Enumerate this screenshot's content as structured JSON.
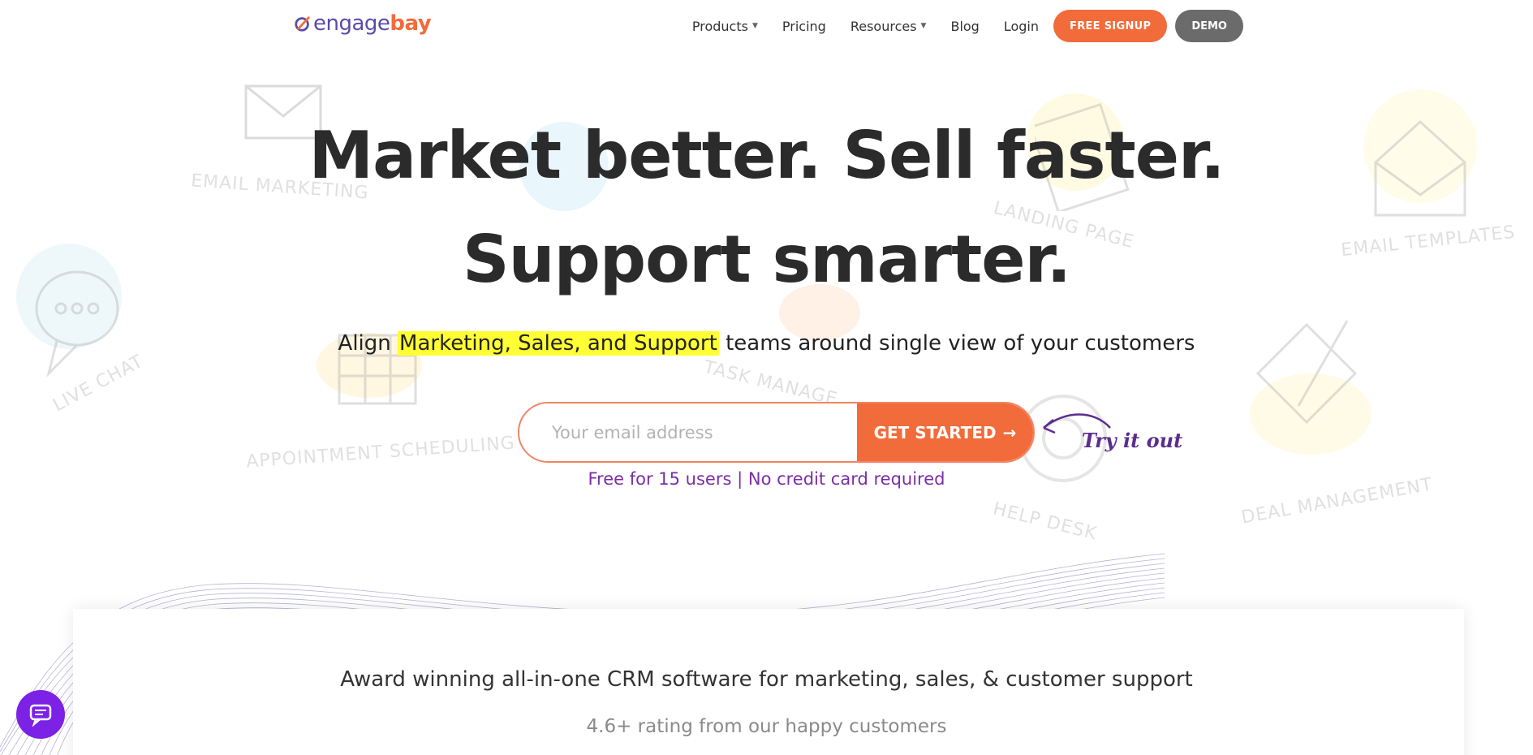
{
  "brand": {
    "engage": "engage",
    "bay": "bay",
    "primary": "#5b4aa8",
    "accent": "#f26b3a"
  },
  "nav": {
    "items": [
      {
        "label": "Products",
        "has_dropdown": true
      },
      {
        "label": "Pricing",
        "has_dropdown": false
      },
      {
        "label": "Resources",
        "has_dropdown": true
      },
      {
        "label": "Blog",
        "has_dropdown": false
      },
      {
        "label": "Login",
        "has_dropdown": false
      }
    ],
    "signup_label": "FREE SIGNUP",
    "demo_label": "DEMO"
  },
  "background_labels": {
    "email_marketing": "EMAIL MARKETING",
    "landing_page": "LANDING PAGE",
    "email_templates": "EMAIL TEMPLATES",
    "live_chat": "LIVE CHAT",
    "task_management": "TASK MANAGE",
    "appointment_scheduling": "APPOINTMENT SCHEDULING",
    "help_desk": "HELP DESK",
    "deal_management": "DEAL MANAGEMENT"
  },
  "hero": {
    "headline_line1": "Market better. Sell faster.",
    "headline_line2": "Support smarter.",
    "sub_before": "Align ",
    "sub_highlight": "Marketing, Sales, and Support",
    "sub_after": " teams around single view of your customers",
    "email_placeholder": "Your email address",
    "cta_label": "GET STARTED",
    "try_label": "Try it out",
    "free_note": "Free for 15 users | No credit card required"
  },
  "award": {
    "title": "Award winning all-in-one CRM software for marketing, sales, & customer support",
    "rating": "4.6+ rating from our happy customers"
  },
  "chat_widget": {
    "icon": "chat-bubble-icon",
    "color": "#7b22e6"
  }
}
